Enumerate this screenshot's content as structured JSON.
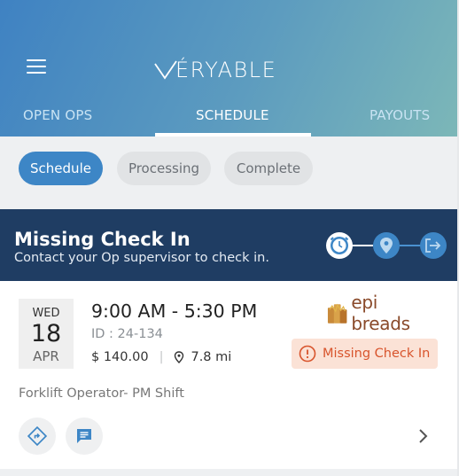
{
  "app": {
    "brand_name": "ÉRYABLE"
  },
  "nav": {
    "tabs": [
      {
        "label": "OPEN OPS"
      },
      {
        "label": "SCHEDULE"
      },
      {
        "label": "PAYOUTS"
      }
    ],
    "active_tab": "SCHEDULE"
  },
  "subtabs": [
    {
      "label": "Schedule"
    },
    {
      "label": "Processing"
    },
    {
      "label": "Complete"
    }
  ],
  "banner": {
    "title": "Missing Check In",
    "subtitle": "Contact your Op supervisor to check in.",
    "steps": [
      "clock-icon",
      "location-pin-icon",
      "check-out-icon"
    ]
  },
  "op_card": {
    "date": {
      "dow": "WED",
      "day": "18",
      "month": "APR"
    },
    "time_range": "9:00 AM - 5:30 PM",
    "op_id": "ID : 24-134",
    "pay": "$ 140.00",
    "distance": "7.8 mi",
    "company": "epi breads",
    "status": "Missing Check In",
    "role": "Forklift Operator- PM Shift"
  },
  "colors": {
    "header_start": "#3f82c2",
    "header_end": "#7cb7b8",
    "banner": "#1f3d63",
    "accent": "#3d86c6",
    "status_bg": "#fbe2d6",
    "status_text": "#d8542c"
  }
}
